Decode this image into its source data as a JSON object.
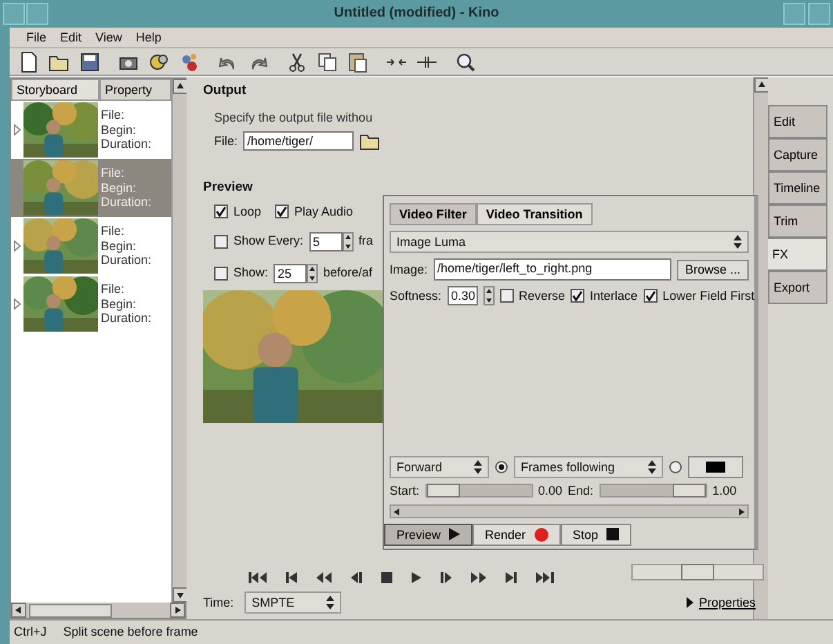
{
  "window": {
    "title": "Untitled (modified) - Kino"
  },
  "menu": [
    {
      "label": "File"
    },
    {
      "label": "Edit"
    },
    {
      "label": "View"
    },
    {
      "label": "Help"
    }
  ],
  "storyboard": {
    "tabs": [
      {
        "label": "Storyboard",
        "selected": true
      },
      {
        "label": "Property",
        "selected": false
      }
    ],
    "clips": [
      {
        "selected": false,
        "lines": [
          "File:",
          "Begin:",
          "Duration:"
        ]
      },
      {
        "selected": true,
        "lines": [
          "File:",
          "Begin:",
          "Duration:"
        ]
      },
      {
        "selected": false,
        "lines": [
          "File:",
          "Begin:",
          "Duration:"
        ]
      },
      {
        "selected": false,
        "lines": [
          "File:",
          "Begin:",
          "Duration:"
        ]
      }
    ]
  },
  "output": {
    "heading": "Output",
    "description": "Specify the output file withou",
    "file_label": "File:",
    "file_value": "/home/tiger/"
  },
  "preview": {
    "heading": "Preview",
    "options": [
      {
        "kind": "inline",
        "label": "Loop",
        "checked": true
      },
      {
        "kind": "inline",
        "label": "Play Audio",
        "checked": true
      },
      {
        "kind": "spin",
        "label": "Show Every:",
        "checked": false,
        "value": "5",
        "unit": "fra"
      },
      {
        "kind": "spin",
        "label": "Show:",
        "checked": false,
        "value": "25",
        "unit": "before/af"
      }
    ]
  },
  "fx": {
    "tabs": [
      {
        "label": "Video Filter",
        "selected": false
      },
      {
        "label": "Video Transition",
        "selected": true
      }
    ],
    "transition": "Image Luma",
    "image_label": "Image:",
    "image_value": "/home/tiger/left_to_right.png",
    "browse": "Browse ...",
    "softness_label": "Softness:",
    "softness_value": "0.30",
    "flags": [
      {
        "label": "Reverse",
        "checked": false
      },
      {
        "label": "Interlace",
        "checked": true
      },
      {
        "label": "Lower Field First",
        "checked": true
      }
    ],
    "direction": "Forward",
    "modes": [
      {
        "kind": "dropdown",
        "selected": true,
        "label": "Frames following"
      },
      {
        "kind": "swatch",
        "selected": false,
        "color": "#000000"
      }
    ],
    "start_label": "Start:",
    "start": {
      "level": 0
    },
    "start_reading": "0.00",
    "end_label": "End:",
    "end": {
      "level": 1
    },
    "end_reading": "1.00",
    "buttons": [
      {
        "kind": "preview",
        "label": "Preview",
        "pressed": true
      },
      {
        "kind": "render",
        "label": "Render",
        "pressed": false
      },
      {
        "kind": "stop",
        "label": "Stop",
        "pressed": false
      }
    ]
  },
  "position": {
    "level": 0.5
  },
  "time": {
    "label": "Time:",
    "value": "SMPTE"
  },
  "properties": {
    "label": "Properties",
    "expanded": false
  },
  "side_tabs": [
    {
      "label": "Edit",
      "selected": false
    },
    {
      "label": "Capture",
      "selected": false
    },
    {
      "label": "Timeline",
      "selected": false
    },
    {
      "label": "Trim",
      "selected": false
    },
    {
      "label": "FX",
      "selected": true
    },
    {
      "label": "Export",
      "selected": false
    }
  ],
  "status_bar": {
    "shortcut": "Ctrl+J",
    "message": "Split scene before frame"
  }
}
